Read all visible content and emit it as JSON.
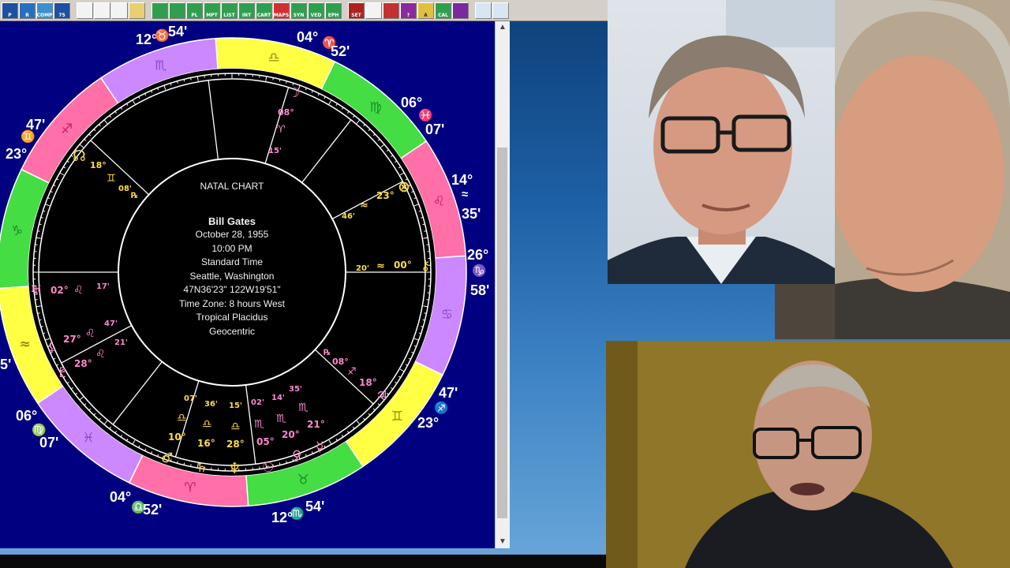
{
  "toolbar": {
    "buttons": [
      {
        "name": "print-icon",
        "label": "P"
      },
      {
        "name": "return-icon",
        "label": "R"
      },
      {
        "name": "compare-icon",
        "label": "COMP"
      },
      {
        "name": "numbers-icon",
        "label": "75"
      },
      {
        "name": "new-file-icon",
        "label": ""
      },
      {
        "name": "save-icon",
        "label": ""
      },
      {
        "name": "document-icon",
        "label": ""
      },
      {
        "name": "folder-icon",
        "label": ""
      },
      {
        "name": "wheel-icon",
        "label": ""
      },
      {
        "name": "chart-wheel-icon",
        "label": ""
      },
      {
        "name": "planets-icon",
        "label": "PL"
      },
      {
        "name": "midpoints-icon",
        "label": "MPT"
      },
      {
        "name": "list-icon",
        "label": "LIST"
      },
      {
        "name": "interpretation-icon",
        "label": "INT"
      },
      {
        "name": "astrocartography-icon",
        "label": "CART"
      },
      {
        "name": "maps-icon",
        "label": "MAPS"
      },
      {
        "name": "synastry-icon",
        "label": "SYN"
      },
      {
        "name": "vedic-icon",
        "label": "VED"
      },
      {
        "name": "ephemeris-icon",
        "label": "EPH"
      },
      {
        "name": "settings-icon",
        "label": "SET"
      },
      {
        "name": "clock-icon",
        "label": ""
      },
      {
        "name": "calculator-icon",
        "label": ""
      },
      {
        "name": "help-icon",
        "label": "?"
      },
      {
        "name": "text-icon",
        "label": "A"
      },
      {
        "name": "calendar-icon",
        "label": "CAL"
      },
      {
        "name": "hand-icon",
        "label": ""
      },
      {
        "name": "zoom-in-icon",
        "label": ""
      },
      {
        "name": "zoom-out-icon",
        "label": ""
      }
    ]
  },
  "chart": {
    "title": "NATAL CHART",
    "name": "Bill Gates",
    "date": "October 28, 1955",
    "time": "10:00 PM",
    "time_type": "Standard Time",
    "place": "Seattle, Washington",
    "coords": "47N36'23\"  122W19'51\"",
    "timezone": "Time Zone: 8 hours West",
    "system": "Tropical Placidus",
    "centric": "Geocentric"
  },
  "cusps": {
    "c10_deg": "04°",
    "c10_sign": "♈",
    "c10_min": "52'",
    "c11_deg": "06°",
    "c11_sign": "♓",
    "c11_min": "07'",
    "c12_deg": "14°",
    "c12_sign": "≈",
    "c12_min": "35'",
    "c1_deg": "26°",
    "c1_sign": "♑",
    "c1_min": "58'",
    "c2_min": "47'",
    "c2_sign": "♐",
    "c2_deg": "23°",
    "c3_deg": "12°",
    "c3_sign": "♏",
    "c3_min": "54'",
    "c4_deg": "04°",
    "c4_sign": "♎",
    "c4_min": "52'",
    "c5_deg": "06°",
    "c5_sign": "♍",
    "c5_min": "07'",
    "c6_deg": "5'",
    "c8_min": "47'",
    "c8_sign": "♊",
    "c8_deg": "23°",
    "c9_deg": "12°",
    "c9_sign": "♉",
    "c9_min": "54'"
  },
  "planets": {
    "moon_deg": "08°",
    "moon_sign": "♈",
    "moon_min": "15'",
    "node_deg": "18°",
    "node_sign": "♊",
    "node_min": "08'",
    "node_r": "℞",
    "pof_deg": "23°",
    "pof_sign": "≈",
    "pof_min": "46'",
    "chiron_deg": "00°",
    "chiron_sign": "≈",
    "chiron_min": "20'",
    "uranus_deg": "02°",
    "uranus_sign": "♌",
    "uranus_min": "17'",
    "pluto_deg": "28°",
    "pluto_sign": "♌",
    "pluto_min": "21'",
    "lilith_deg": "27°",
    "lilith_sign": "♌",
    "lilith_min": "47'",
    "jupiter_r": "℞",
    "jupiter_deg": "08°",
    "jupiter_sign": "♐",
    "jupiter_min": "18°",
    "venus_min": "35'",
    "venus_deg": "21°",
    "venus_sign": "♏",
    "sun_min": "14'",
    "sun_deg": "05°",
    "sun_sign": "♏",
    "sun_sub": "02'",
    "mercury_deg": "20°",
    "mercury_sign": "♏",
    "neptune_deg": "28°",
    "neptune_min": "15'",
    "saturn_deg": "16°",
    "saturn_min": "36'",
    "mars_deg": "10°",
    "mars_min": "07'"
  },
  "colors": {
    "window_bg": "#000080",
    "fire": "#ff6fa8",
    "earth": "#44dd44",
    "air": "#ffff44",
    "water": "#cc88ff",
    "cusp_text": "#ffffff",
    "planet_text": "#ffdd44",
    "planet_pink": "#ff88cc"
  }
}
